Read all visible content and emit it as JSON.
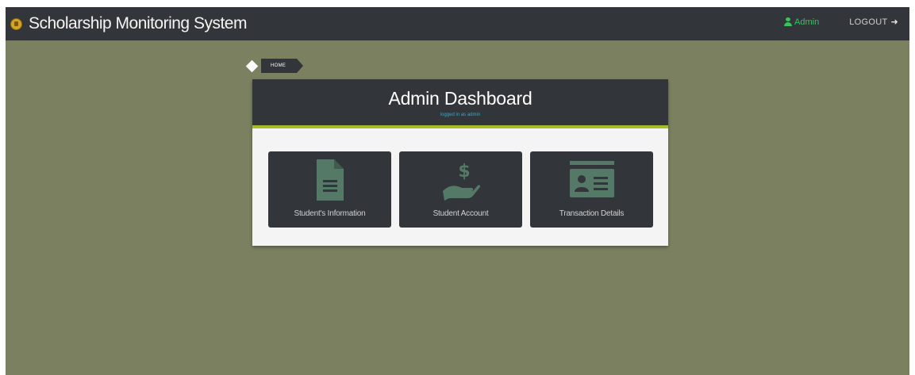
{
  "app": {
    "title": "Scholarship Monitoring System"
  },
  "nav": {
    "admin_label": "Admin",
    "logout_label": "LOGOUT"
  },
  "breadcrumb": {
    "home_label": "HOME"
  },
  "dashboard": {
    "title": "Admin Dashboard",
    "subtitle": "logged in as admin",
    "tiles": [
      {
        "label": "Student's Information",
        "icon": "document-icon"
      },
      {
        "label": "Student Account",
        "icon": "hand-dollar-icon"
      },
      {
        "label": "Transaction Details",
        "icon": "id-card-icon"
      }
    ]
  },
  "colors": {
    "background": "#7b8160",
    "navbar": "#323539",
    "accent_bar": "#a7ba28",
    "tile_icon": "#547a67",
    "admin_link": "#36c45b"
  }
}
